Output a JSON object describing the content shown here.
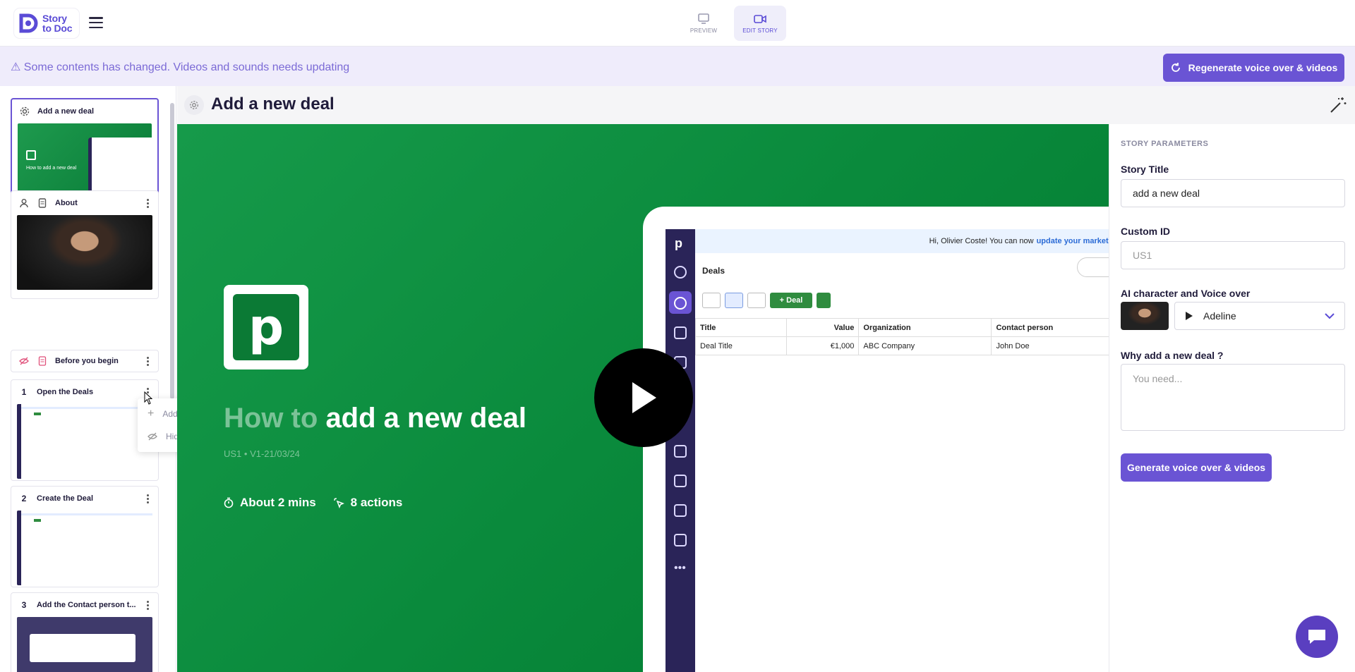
{
  "header": {
    "logo_text_line1": "Story",
    "logo_text_line2": "to Doc",
    "modes": [
      {
        "label": "PREVIEW",
        "icon": "monitor-icon",
        "active": false
      },
      {
        "label": "EDIT STORY",
        "icon": "video-camera-icon",
        "active": true
      }
    ]
  },
  "banner": {
    "text": "⚠ Some contents has changed. Videos and sounds needs updating",
    "button_label": "Regenerate voice over & videos"
  },
  "sidebar": {
    "cards": [
      {
        "title": "Add a new deal",
        "icon": "gear-icon",
        "selected": true
      },
      {
        "title": "About",
        "icon": "person-icon",
        "secondary_icon": "document-icon"
      },
      {
        "title": "Before you begin",
        "icon": "eye-off-icon",
        "secondary_icon": "checklist-icon"
      },
      {
        "number": "1",
        "title": "Open the Deals"
      },
      {
        "number": "2",
        "title": "Create the Deal"
      },
      {
        "number": "3",
        "title": "Add the Contact person t..."
      }
    ],
    "context_menu": {
      "items": [
        {
          "label": "Add Annotation",
          "icon": "plus-icon"
        },
        {
          "label": "Hide step",
          "icon": "eye-off-icon"
        }
      ]
    }
  },
  "main": {
    "title": "Add a new deal",
    "preview": {
      "howto_prefix": "How to",
      "howto_title": "add a new deal",
      "meta": "US1 • V1-21/03/24",
      "duration": "About 2 mins",
      "actions": "8 actions",
      "logo_letter": "p",
      "mock": {
        "notice": "Hi, Olivier Coste! You can now",
        "notice_link": "update your marketing pref",
        "deals_label": "Deals",
        "deal_button": "+ Deal",
        "columns": [
          "Title",
          "Value",
          "Organization",
          "Contact person"
        ],
        "rows": [
          [
            "Deal Title",
            "€1,000",
            "ABC Company",
            "John Doe"
          ]
        ]
      }
    }
  },
  "panel": {
    "section_label": "STORY PARAMETERS",
    "story_title_label": "Story Title",
    "story_title_value": "add a new deal",
    "custom_id_label": "Custom ID",
    "custom_id_placeholder": "US1",
    "ai_label": "AI character and Voice over",
    "voice_value": "Adeline",
    "why_label": "Why add a new deal ?",
    "why_placeholder": "You need...",
    "generate_label": "Generate voice over & videos"
  },
  "colors": {
    "accent": "#6a54d4",
    "banner_bg": "#efecfb",
    "stage_green": "#0a8a3c"
  }
}
